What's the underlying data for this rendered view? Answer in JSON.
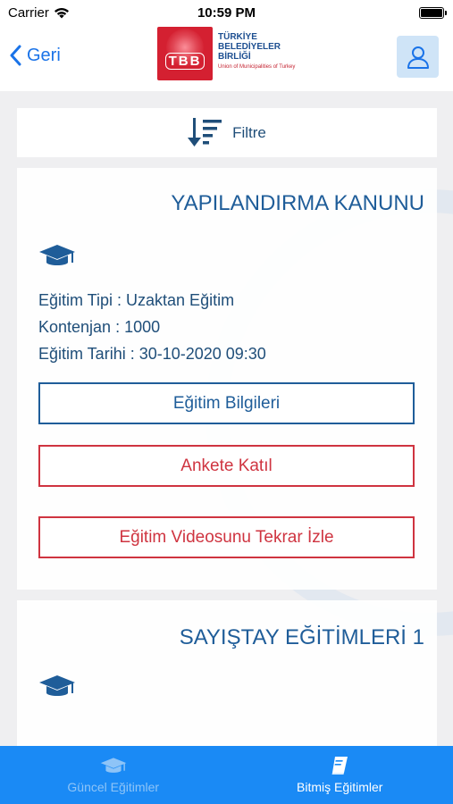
{
  "status_bar": {
    "carrier": "Carrier",
    "time": "10:59 PM"
  },
  "nav": {
    "back_label": "Geri",
    "logo": {
      "mark": "TBB",
      "lines": [
        "TÜRKİYE",
        "BELEDİYELER",
        "BİRLİĞİ"
      ],
      "english": "Union of Municipalities of Turkey"
    }
  },
  "filter": {
    "label": "Filtre"
  },
  "cards": [
    {
      "title": "YAPILANDIRMA KANUNU",
      "type_line": "Eğitim Tipi : Uzaktan Eğitim",
      "quota_line": "Kontenjan : 1000",
      "date_line": "Eğitim Tarihi : 30-10-2020 09:30",
      "buttons": {
        "info": "Eğitim Bilgileri",
        "survey": "Ankete Katıl",
        "replay": "Eğitim Videosunu Tekrar İzle"
      }
    },
    {
      "title": "SAYIŞTAY EĞİTİMLERİ 1"
    }
  ],
  "tabs": [
    {
      "label": "Güncel Eğitimler",
      "icon": "graduation-cap-icon",
      "active": false
    },
    {
      "label": "Bitmiş Eğitimler",
      "icon": "book-icon",
      "active": true
    }
  ],
  "colors": {
    "accent": "#1a8af5",
    "title_blue": "#1f5d99",
    "danger": "#cf3440"
  }
}
